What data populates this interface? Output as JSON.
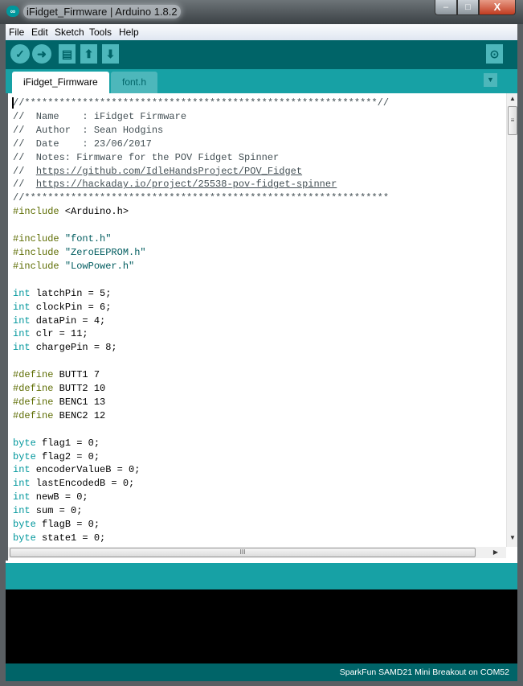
{
  "window": {
    "title": "iFidget_Firmware | Arduino 1.8.2",
    "app_icon": "arduino-infinity-icon",
    "controls": {
      "minimize": "–",
      "maximize": "□",
      "close": "X"
    }
  },
  "menu": [
    "File",
    "Edit",
    "Sketch",
    "Tools",
    "Help"
  ],
  "toolbar": {
    "verify": "✓",
    "upload": "➜",
    "new": "▤",
    "open": "⬆",
    "save": "⬇",
    "serial_monitor": "⊙"
  },
  "tabs": [
    {
      "label": "iFidget_Firmware",
      "active": true
    },
    {
      "label": "font.h",
      "active": false
    }
  ],
  "tab_menu": "▼",
  "colors": {
    "toolbar": "#006468",
    "tabbar": "#17a1a5",
    "type": "#00979c",
    "preprocessor": "#5e6d03",
    "string": "#005c5f"
  },
  "code": [
    [
      [
        "comment",
        "//*************************************************************//"
      ]
    ],
    [
      [
        "comment",
        "//  Name    : iFidget Firmware"
      ]
    ],
    [
      [
        "comment",
        "//  Author  : Sean Hodgins"
      ]
    ],
    [
      [
        "comment",
        "//  Date    : 23/06/2017"
      ]
    ],
    [
      [
        "comment",
        "//  Notes: Firmware for the POV Fidget Spinner"
      ]
    ],
    [
      [
        "comment",
        "//  "
      ],
      [
        "link",
        "https://github.com/IdleHandsProject/POV_Fidget"
      ]
    ],
    [
      [
        "comment",
        "//  "
      ],
      [
        "link",
        "https://hackaday.io/project/25538-pov-fidget-spinner"
      ]
    ],
    [
      [
        "comment",
        "//***************************************************************"
      ]
    ],
    [
      [
        "pre",
        "#include"
      ],
      [
        "plain",
        " <Arduino.h>"
      ]
    ],
    [],
    [
      [
        "pre",
        "#include"
      ],
      [
        "plain",
        " "
      ],
      [
        "str",
        "\"font.h\""
      ]
    ],
    [
      [
        "pre",
        "#include"
      ],
      [
        "plain",
        " "
      ],
      [
        "str",
        "\"ZeroEEPROM.h\""
      ]
    ],
    [
      [
        "pre",
        "#include"
      ],
      [
        "plain",
        " "
      ],
      [
        "str",
        "\"LowPower.h\""
      ]
    ],
    [],
    [
      [
        "type",
        "int"
      ],
      [
        "plain",
        " latchPin = 5;"
      ]
    ],
    [
      [
        "type",
        "int"
      ],
      [
        "plain",
        " clockPin = 6;"
      ]
    ],
    [
      [
        "type",
        "int"
      ],
      [
        "plain",
        " dataPin = 4;"
      ]
    ],
    [
      [
        "type",
        "int"
      ],
      [
        "plain",
        " clr = 11;"
      ]
    ],
    [
      [
        "type",
        "int"
      ],
      [
        "plain",
        " chargePin = 8;"
      ]
    ],
    [],
    [
      [
        "pre",
        "#define"
      ],
      [
        "plain",
        " BUTT1 7"
      ]
    ],
    [
      [
        "pre",
        "#define"
      ],
      [
        "plain",
        " BUTT2 10"
      ]
    ],
    [
      [
        "pre",
        "#define"
      ],
      [
        "plain",
        " BENC1 13"
      ]
    ],
    [
      [
        "pre",
        "#define"
      ],
      [
        "plain",
        " BENC2 12"
      ]
    ],
    [],
    [
      [
        "type",
        "byte"
      ],
      [
        "plain",
        " flag1 = 0;"
      ]
    ],
    [
      [
        "type",
        "byte"
      ],
      [
        "plain",
        " flag2 = 0;"
      ]
    ],
    [
      [
        "type",
        "int"
      ],
      [
        "plain",
        " encoderValueB = 0;"
      ]
    ],
    [
      [
        "type",
        "int"
      ],
      [
        "plain",
        " lastEncodedB = 0;"
      ]
    ],
    [
      [
        "type",
        "int"
      ],
      [
        "plain",
        " newB = 0;"
      ]
    ],
    [
      [
        "type",
        "int"
      ],
      [
        "plain",
        " sum = 0;"
      ]
    ],
    [
      [
        "type",
        "byte"
      ],
      [
        "plain",
        " flagB = 0;"
      ]
    ],
    [
      [
        "type",
        "byte"
      ],
      [
        "plain",
        " state1 = 0;"
      ]
    ]
  ],
  "scrollbar": {
    "up": "▲",
    "down": "▼",
    "right": "▶",
    "grip": "≡",
    "hgrip": "III"
  },
  "status": {
    "board": "SparkFun SAMD21 Mini Breakout on COM52"
  }
}
